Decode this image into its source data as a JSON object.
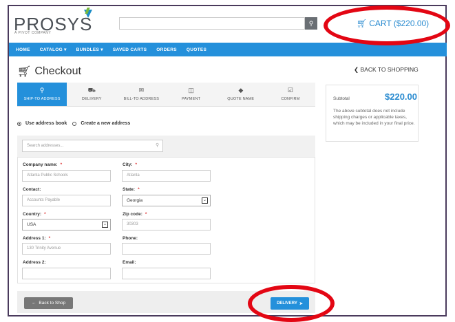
{
  "header": {
    "logo_text": "PROSYS",
    "logo_tagline": "A PIVOT COMPANY",
    "search_placeholder": "",
    "cart_label": "CART ($220.00)"
  },
  "nav": {
    "items": [
      {
        "label": "HOME"
      },
      {
        "label": "CATALOG ▾"
      },
      {
        "label": "BUNDLES ▾"
      },
      {
        "label": "SAVED CARTS"
      },
      {
        "label": "ORDERS"
      },
      {
        "label": "QUOTES"
      }
    ]
  },
  "page": {
    "title": "Checkout",
    "back_link": "BACK TO SHOPPING"
  },
  "steps": [
    {
      "label": "SHIP-TO ADDRESS",
      "icon": "map-marker"
    },
    {
      "label": "DELIVERY",
      "icon": "truck"
    },
    {
      "label": "BILL-TO ADDRESS",
      "icon": "envelope"
    },
    {
      "label": "PAYMENT",
      "icon": "money"
    },
    {
      "label": "QUOTE NAME",
      "icon": "tag"
    },
    {
      "label": "CONFIRM",
      "icon": "check-square"
    }
  ],
  "address_mode": {
    "option1": "Use address book",
    "option2": "Create a new address"
  },
  "form": {
    "search_placeholder": "Search addresses...",
    "company_label": "Company name:",
    "company_value": "Atlanta Public Schools",
    "contact_label": "Contact:",
    "contact_value": "Accounts Payable",
    "country_label": "Country:",
    "country_value": "USA",
    "address1_label": "Address 1:",
    "address1_value": "130 Trinity Avenue",
    "address2_label": "Address 2:",
    "address2_value": "",
    "city_label": "City:",
    "city_value": "Atlanta",
    "state_label": "State:",
    "state_value": "Georgia",
    "zip_label": "Zip code:",
    "zip_value": "30303",
    "phone_label": "Phone:",
    "phone_value": "",
    "email_label": "Email:",
    "email_value": "",
    "required_mark": "*"
  },
  "footer": {
    "back_label": "Back to Shop",
    "next_label": "DELIVERY"
  },
  "summary": {
    "subtotal_label": "Subtotal",
    "subtotal_value": "$220.00",
    "note": "The above subtotal does not include shipping charges or applicable taxes, which may be included in your final price."
  },
  "colors": {
    "accent": "#2490db",
    "annotation": "#e30613"
  }
}
